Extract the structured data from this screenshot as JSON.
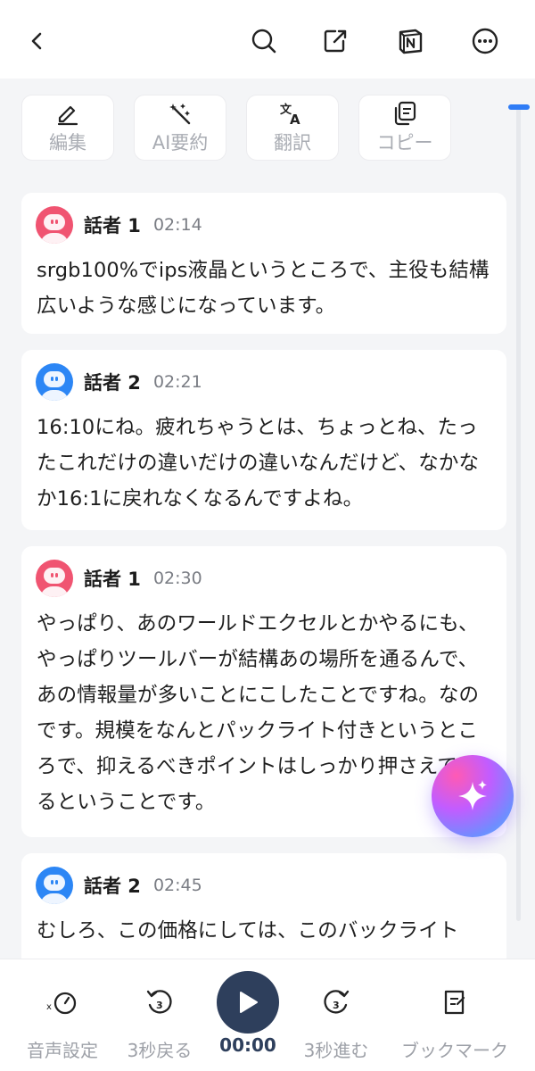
{
  "header": {
    "icons": [
      "back-arrow-icon",
      "search-icon",
      "export-icon",
      "notion-icon",
      "more-icon"
    ]
  },
  "actions": [
    {
      "label": "編集",
      "icon": "pen-icon"
    },
    {
      "label": "AI要約",
      "icon": "magic-wand-icon"
    },
    {
      "label": "翻訳",
      "icon": "translate-icon"
    },
    {
      "label": "コピー",
      "icon": "copy-icon"
    }
  ],
  "transcript": [
    {
      "speaker": "話者 1",
      "time": "02:14",
      "avatar_color": "#f05471",
      "text": "srgb100%でips液晶というところで、主役も結構広いような感じになっています。"
    },
    {
      "speaker": "話者 2",
      "time": "02:21",
      "avatar_color": "#2c86f5",
      "text": "16:10にね。疲れちゃうとは、ちょっとね、たったこれだけの違いだけの違いなんだけど、なかなか16:1に戻れなくなるんですよね。"
    },
    {
      "speaker": "話者 1",
      "time": "02:30",
      "avatar_color": "#f05471",
      "text": "やっぱり、あのワールドエクセルとかやるにも、やっぱりツールバーが結構あの場所を通るんで、あの情報量が多いことにこしたことですね。なのです。規模をなんとパックライト付きというところで、抑えるべきポイントはしっかり押さえているということです。"
    },
    {
      "speaker": "話者 2",
      "time": "02:45",
      "avatar_color": "#2c86f5",
      "text": "むしろ、この価格にしては、このバックライト"
    }
  ],
  "player": {
    "audio_settings_label": "音声設定",
    "rewind_label": "3秒戻る",
    "current_time": "00:00",
    "forward_label": "3秒進む",
    "bookmark_label": "ブックマーク"
  },
  "colors": {
    "accent": "#2f7cf6",
    "play_button": "#2e3f5c",
    "speaker1": "#f05471",
    "speaker2": "#2c86f5"
  }
}
